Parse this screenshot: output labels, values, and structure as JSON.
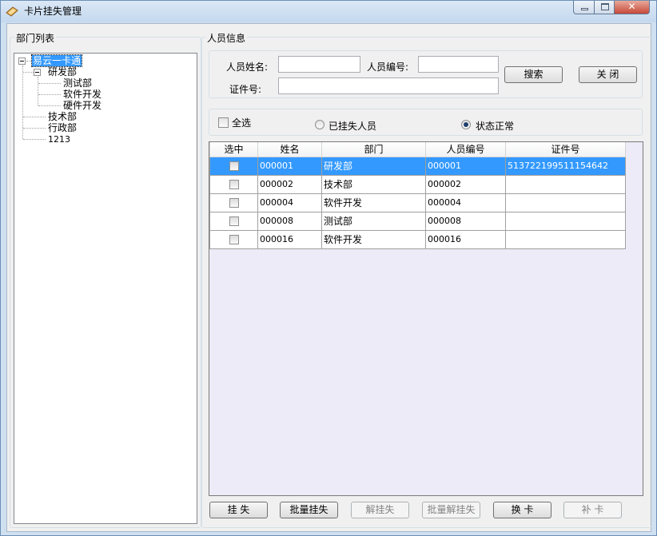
{
  "window": {
    "title": "卡片挂失管理"
  },
  "dept_panel": {
    "title": "部门列表",
    "tree": {
      "root": "易云一卡通",
      "children": [
        "研发部",
        "测试部",
        "软件开发",
        "硬件开发",
        "技术部",
        "行政部",
        "1213"
      ]
    }
  },
  "person_panel": {
    "title": "人员信息",
    "search": {
      "name_label": "人员姓名:",
      "name_value": "",
      "number_label": "人员编号:",
      "number_value": "",
      "id_label": "证件号:",
      "id_value": "",
      "search_button": "搜索",
      "close_button": "关 闭"
    },
    "filter": {
      "select_all": "全选",
      "lost_option": "已挂失人员",
      "normal_option": "状态正常",
      "selected": "状态正常"
    },
    "table": {
      "columns": [
        "选中",
        "姓名",
        "部门",
        "人员编号",
        "证件号"
      ],
      "rows": [
        {
          "name": "000001",
          "dept": "研发部",
          "number": "000001",
          "id": "513722199511154642",
          "selected": true
        },
        {
          "name": "000002",
          "dept": "技术部",
          "number": "000002",
          "id": "",
          "selected": false
        },
        {
          "name": "000004",
          "dept": "软件开发",
          "number": "000004",
          "id": "",
          "selected": false
        },
        {
          "name": "000008",
          "dept": "测试部",
          "number": "000008",
          "id": "",
          "selected": false
        },
        {
          "name": "000016",
          "dept": "软件开发",
          "number": "000016",
          "id": "",
          "selected": false
        }
      ]
    },
    "actions": {
      "report_loss": "挂 失",
      "batch_report_loss": "批量挂失",
      "cancel_loss": "解挂失",
      "batch_cancel_loss": "批量解挂失",
      "replace_card": "换 卡",
      "reissue_card": "补 卡"
    }
  }
}
